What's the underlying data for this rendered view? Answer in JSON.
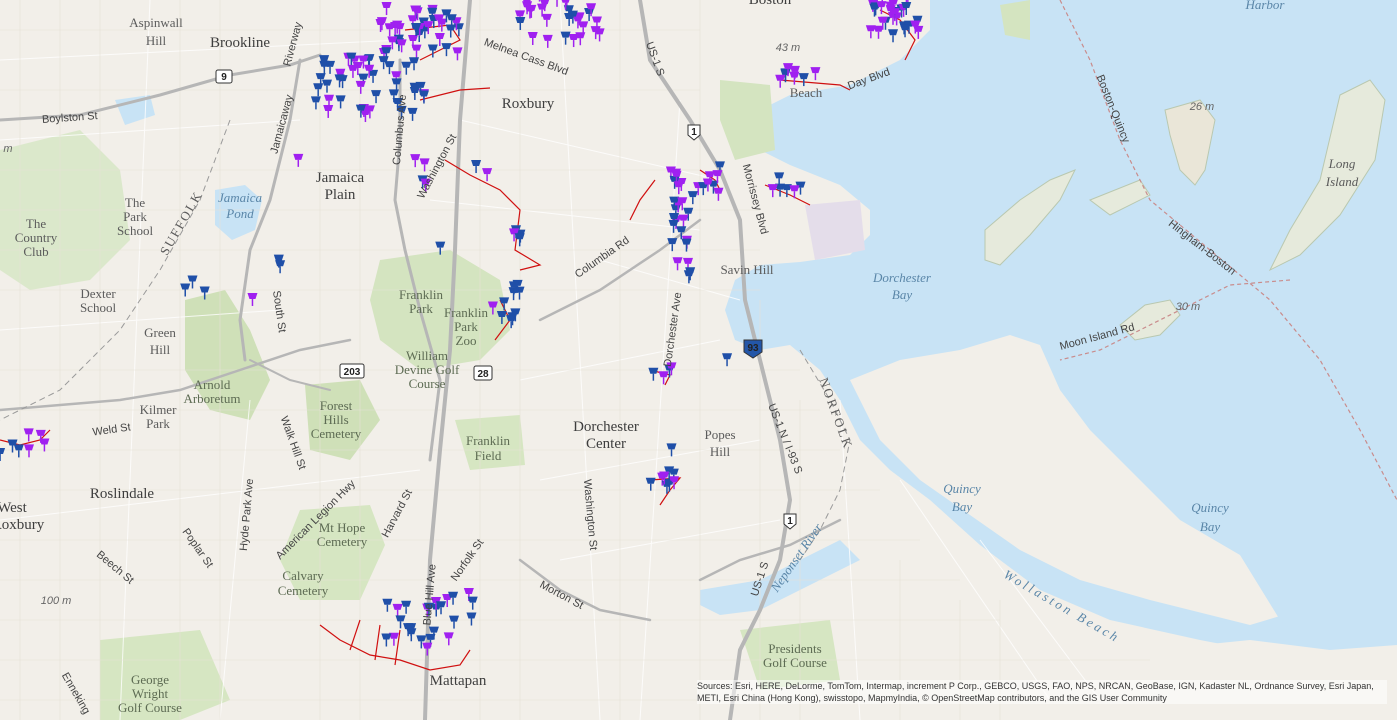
{
  "map": {
    "places": {
      "brookline": "Brookline",
      "roxbury": "Roxbury",
      "jamaica_plain_1": "Jamaica",
      "jamaica_plain_2": "Plain",
      "boston": "Boston",
      "dorchester_center_1": "Dorchester",
      "dorchester_center_2": "Center",
      "roslindale": "Roslindale",
      "west_roxbury_1": "West",
      "west_roxbury_2": "Roxbury",
      "mattapan": "Mattapan"
    },
    "neighborhoods": {
      "aspinwall_1": "Aspinwall",
      "aspinwall_2": "Hill",
      "park_school_1": "The",
      "park_school_2": "Park",
      "park_school_3": "School",
      "country_club_1": "The",
      "country_club_2": "Country",
      "country_club_3": "Club",
      "dexter_1": "Dexter",
      "dexter_2": "School",
      "green_hill_1": "Green",
      "green_hill_2": "Hill",
      "kilmer_1": "Kilmer",
      "kilmer_2": "Park",
      "savin_hill": "Savin Hill",
      "popes_hill_1": "Popes",
      "popes_hill_2": "Hill",
      "beach": "Beach",
      "harbor": "Harbor",
      "long_island_1": "Long",
      "long_island_2": "Island"
    },
    "parks": {
      "franklin_park_1": "Franklin",
      "franklin_park_2": "Park",
      "franklin_zoo_1": "Franklin",
      "franklin_zoo_2": "Park",
      "franklin_zoo_3": "Zoo",
      "william_1": "William",
      "william_2": "Devine Golf",
      "william_3": "Course",
      "arnold_1": "Arnold",
      "arnold_2": "Arboretum",
      "forest_hills_1": "Forest",
      "forest_hills_2": "Hills",
      "forest_hills_3": "Cemetery",
      "franklin_field_1": "Franklin",
      "franklin_field_2": "Field",
      "mt_hope_1": "Mt Hope",
      "mt_hope_2": "Cemetery",
      "calvary_1": "Calvary",
      "calvary_2": "Cemetery",
      "presidents_1": "Presidents",
      "presidents_2": "Golf Course",
      "george_1": "George",
      "george_2": "Wright",
      "george_3": "Golf Course",
      "suffolk": "SUFFOLK",
      "norfolk": "NORFOLK"
    },
    "water": {
      "jamaica_pond_1": "Jamaica",
      "jamaica_pond_2": "Pond",
      "dorchester_bay_1": "Dorchester",
      "dorchester_bay_2": "Bay",
      "quincy_bay_a1": "Quincy",
      "quincy_bay_a2": "Bay",
      "quincy_bay_b1": "Quincy",
      "quincy_bay_b2": "Bay",
      "wollaston": "Wollaston Beach",
      "neponset": "Neponset River",
      "boston_quincy": "Boston-Quincy",
      "hingham_boston": "Hingham-Boston"
    },
    "roads": {
      "boylston": "Boylston St",
      "riverway": "Riverway",
      "jamaicaway": "Jamaicaway",
      "columbus": "Columbus Ave",
      "washington_n": "Washington St",
      "melnea": "Melnea Cass Blvd",
      "us1": "US-1 S",
      "morrissey": "Morrissey Blvd",
      "columbia": "Columbia Rd",
      "dorchester_ave": "Dorchester Ave",
      "south_st": "South St",
      "weld": "Weld St",
      "walk_hill": "Walk Hill St",
      "hyde_park": "Hyde Park Ave",
      "american_legion": "American Legion Hwy",
      "harvard": "Harvard St",
      "blue_hill": "Blue Hill Ave",
      "norfolk_st": "Norfolk St",
      "morton": "Morton St",
      "washington_s": "Washington St",
      "us1_i93": "US-1 N / I-93 S",
      "us1_s2": "US-1 S",
      "moon_island": "Moon Island Rd",
      "day_blvd": "Day Blvd",
      "poplar": "Poplar St",
      "beech": "Beech St",
      "enneking": "Enneking"
    },
    "shields": {
      "rt9": "9",
      "us1_n": "1",
      "rt28": "28",
      "rt203": "203",
      "i93": "93",
      "us1_s": "1"
    },
    "elevations": {
      "e43": "43 m",
      "e26": "26 m",
      "e30": "30 m",
      "e100": "100 m",
      "e_left": "m"
    },
    "attribution": "Sources: Esri, HERE, DeLorme, TomTom, Intermap, increment P Corp., GEBCO, USGS, FAO, NPS, NRCAN, GeoBase, IGN, Kadaster NL, Ordnance Survey, Esri Japan, METI, Esri China (Hong Kong), swisstopo, MapmyIndia, © OpenStreetMap contributors, and the GIS User Community",
    "colors": {
      "land": "#f2efe9",
      "water": "#c8e3f5",
      "park": "#d4e4c0",
      "pin_purple": "#a020f0",
      "pin_blue": "#1f4fa8",
      "route_red": "#d01010"
    }
  }
}
